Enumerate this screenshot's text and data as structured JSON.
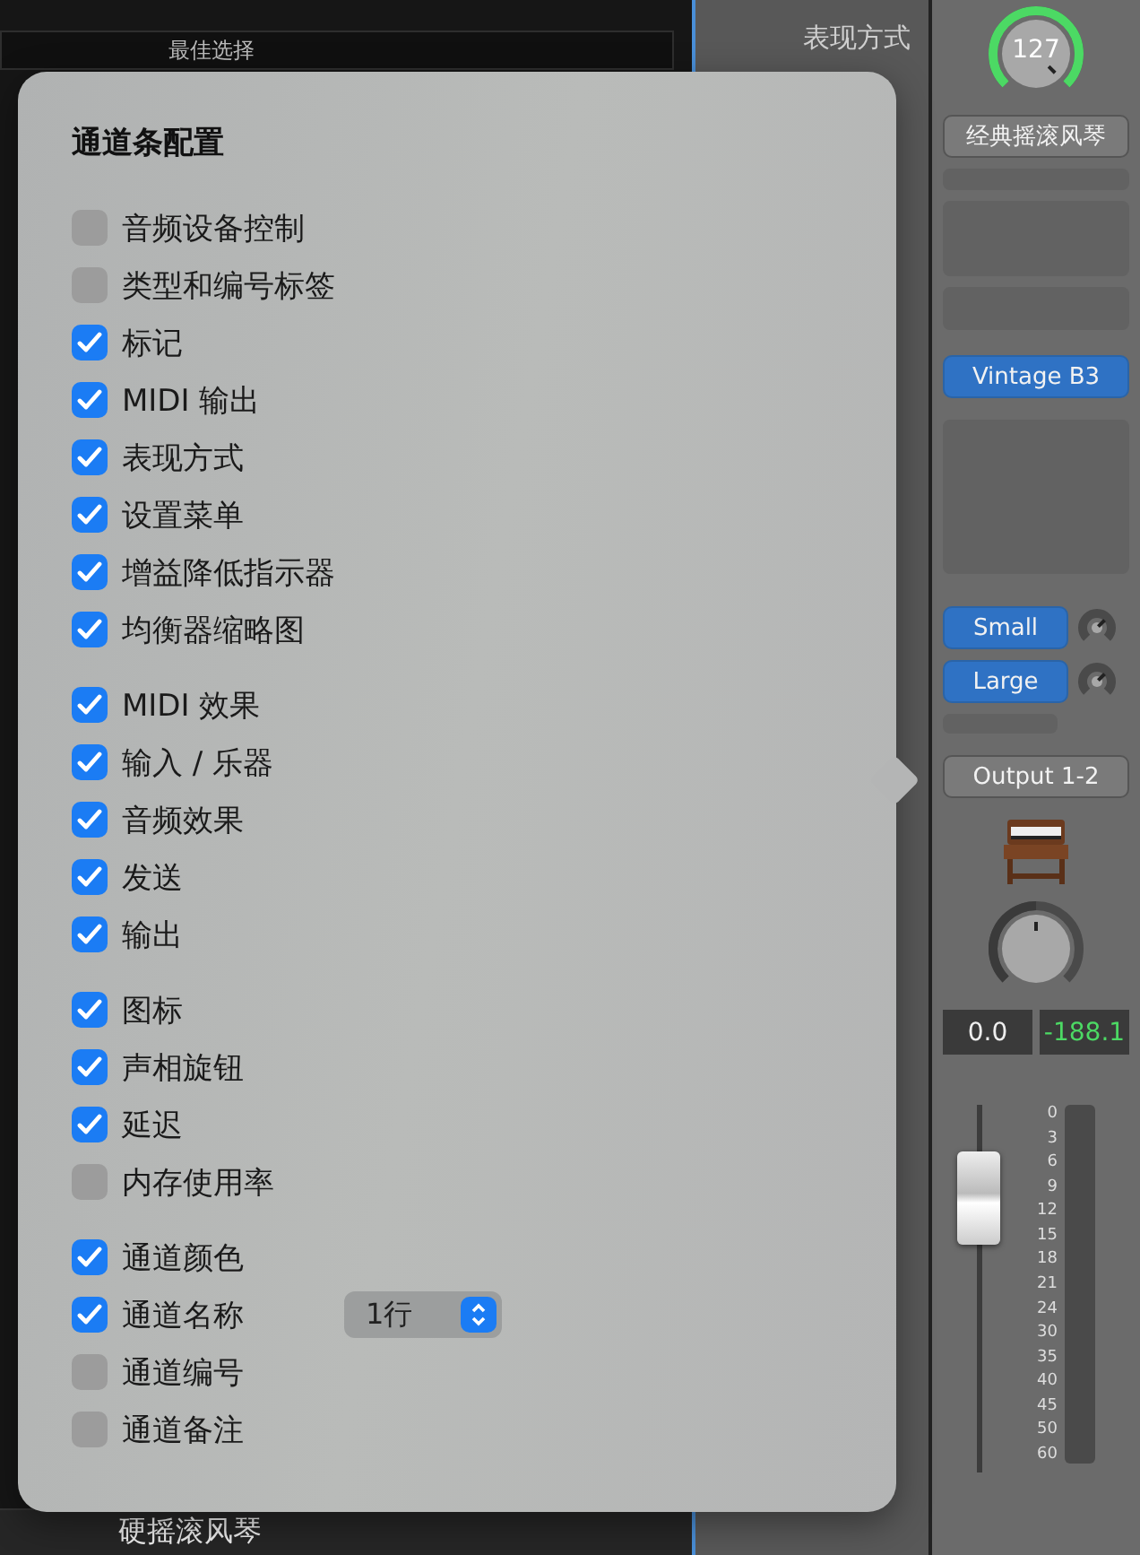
{
  "top_header": {
    "label": "最佳选择"
  },
  "track_name": "硬摇滚风琴",
  "side_label": "表现方式",
  "channel_strip": {
    "setting_knob": {
      "value": "127"
    },
    "setting": "经典摇滚风琴",
    "instrument": "Vintage B3",
    "sends": [
      {
        "name": "Small"
      },
      {
        "name": "Large"
      }
    ],
    "output": "Output 1-2",
    "gain": "0.0",
    "peak": "-188.1",
    "fader": {
      "level": 0.74,
      "scale": [
        "0",
        "3",
        "6",
        "9",
        "12",
        "15",
        "18",
        "21",
        "24",
        "30",
        "35",
        "40",
        "45",
        "50",
        "60"
      ]
    }
  },
  "popover": {
    "title": "通道条配置",
    "groups": [
      [
        {
          "label": "音频设备控制",
          "checked": false
        },
        {
          "label": "类型和编号标签",
          "checked": false
        },
        {
          "label": "标记",
          "checked": true
        },
        {
          "label": "MIDI 输出",
          "checked": true
        },
        {
          "label": "表现方式",
          "checked": true
        },
        {
          "label": "设置菜单",
          "checked": true
        },
        {
          "label": "增益降低指示器",
          "checked": true
        },
        {
          "label": "均衡器缩略图",
          "checked": true
        }
      ],
      [
        {
          "label": "MIDI 效果",
          "checked": true
        },
        {
          "label": "输入 / 乐器",
          "checked": true
        },
        {
          "label": "音频效果",
          "checked": true
        },
        {
          "label": "发送",
          "checked": true
        },
        {
          "label": "输出",
          "checked": true
        }
      ],
      [
        {
          "label": "图标",
          "checked": true
        },
        {
          "label": "声相旋钮",
          "checked": true
        },
        {
          "label": "延迟",
          "checked": true
        },
        {
          "label": "内存使用率",
          "checked": false
        }
      ],
      [
        {
          "label": "通道颜色",
          "checked": true
        },
        {
          "label": "通道名称",
          "checked": true,
          "stepper": "1行"
        },
        {
          "label": "通道编号",
          "checked": false
        },
        {
          "label": "通道备注",
          "checked": false
        }
      ]
    ]
  }
}
